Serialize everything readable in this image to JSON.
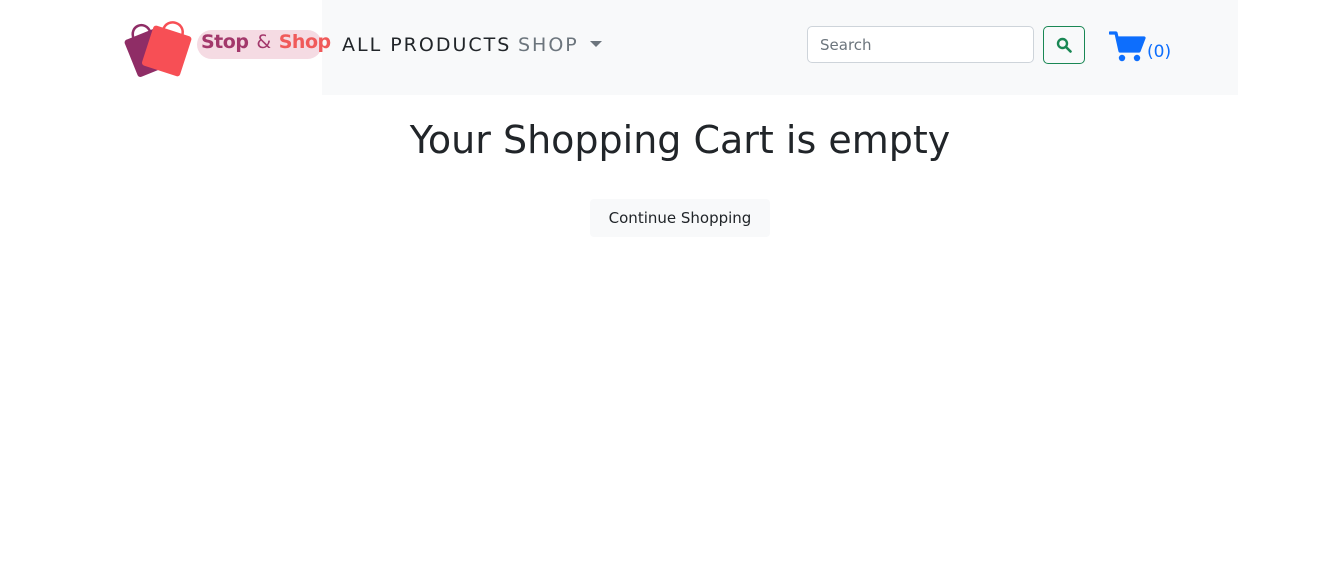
{
  "brand": {
    "word1": "Stop",
    "amp": "&",
    "word2": "Shop"
  },
  "nav": {
    "all_products": "ALL PRODUCTS",
    "shop": "SHOP"
  },
  "search": {
    "placeholder": "Search",
    "value": "",
    "button_icon": "search-icon"
  },
  "cart": {
    "icon": "cart-icon",
    "count": "(0)"
  },
  "main": {
    "heading": "Your Shopping Cart is empty",
    "continue_label": "Continue Shopping"
  },
  "colors": {
    "navbar_bg": "#f8f9fa",
    "brand_purple": "#a3386b",
    "brand_coral": "#f05a5a",
    "search_green": "#198754",
    "cart_blue": "#0d6efd"
  }
}
